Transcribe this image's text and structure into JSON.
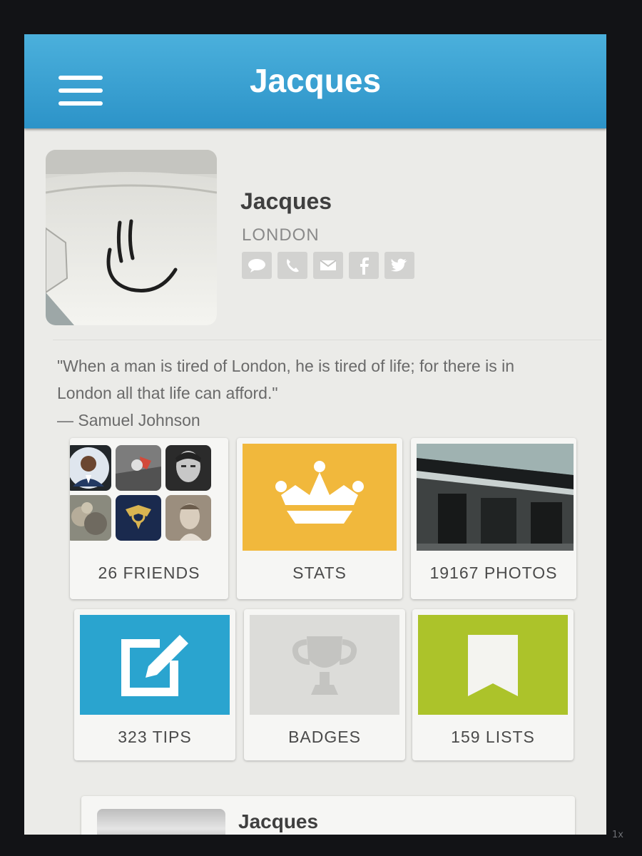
{
  "header": {
    "title": "Jacques"
  },
  "profile": {
    "name": "Jacques",
    "city": "LONDON",
    "contacts": [
      "message-icon",
      "phone-icon",
      "email-icon",
      "facebook-icon",
      "twitter-icon"
    ]
  },
  "quote": {
    "text": "\"When a man is tired of London, he is tired of life; for there is in London all that life can afford.\"",
    "author": "— Samuel Johnson"
  },
  "tiles": {
    "friends": "26 FRIENDS",
    "stats": "STATS",
    "photos": "19167 PHOTOS",
    "tips": "323 TIPS",
    "badges": "BADGES",
    "lists": "159 LISTS"
  },
  "colors": {
    "navbar": "#2c93c8",
    "stats": "#f1b83c",
    "tips": "#2aa4cf",
    "lists": "#acc32a"
  },
  "bottom_card": {
    "name": "Jacques"
  },
  "bezel": {
    "zoom": "1x"
  }
}
